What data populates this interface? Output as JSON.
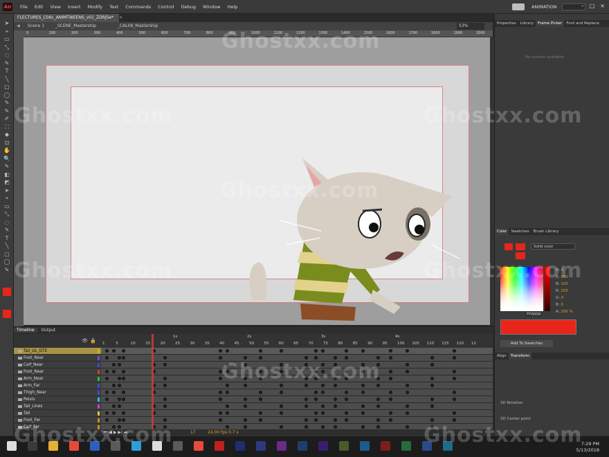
{
  "app": {
    "logo": "An",
    "menus": [
      "File",
      "Edit",
      "View",
      "Insert",
      "Modify",
      "Text",
      "Commands",
      "Control",
      "Debug",
      "Window",
      "Help"
    ],
    "workspace": "ANIMATION",
    "document_tab": "FLECTURES_C06c_ANIMTWEENS_v01_ZDRJ5e*",
    "accent": "#e8251b"
  },
  "scene": {
    "scene": "Scene 1",
    "symbol1": "_SCENE_Mastership",
    "symbol2": "_CAL08_Mastership",
    "zoom": "53%"
  },
  "ruler_ticks": [
    "0",
    "100",
    "200",
    "300",
    "400",
    "500",
    "600",
    "700",
    "800",
    "900",
    "1000",
    "1100",
    "1200",
    "1300",
    "1400",
    "1500",
    "1600",
    "1700",
    "1800",
    "1900",
    "2000"
  ],
  "timeline": {
    "tabs": [
      "Timeline",
      "Output"
    ],
    "seconds": [
      "1s",
      "2s",
      "3s",
      "4s"
    ],
    "frames": [
      "1",
      "5",
      "10",
      "15",
      "20",
      "25",
      "30",
      "35",
      "40",
      "45",
      "50",
      "55",
      "60",
      "65",
      "70",
      "75",
      "80",
      "85",
      "90",
      "95",
      "100",
      "105",
      "110",
      "115",
      "120",
      "12"
    ],
    "layers": [
      {
        "name": "Tail_UL_DTE",
        "color": "#d4b500",
        "selected": true
      },
      {
        "name": "Foot_Near",
        "color": "#7a4dd8"
      },
      {
        "name": "Calf_Near",
        "color": "#3a4bd8"
      },
      {
        "name": "Foot_Near",
        "color": "#d83a3a"
      },
      {
        "name": "Arm_Near",
        "color": "#32c032"
      },
      {
        "name": "Arm_Far",
        "color": "#3a4bd8"
      },
      {
        "name": "Thigh_Near",
        "color": "#3a4bd8"
      },
      {
        "name": "Pelvis",
        "color": "#32c0c0"
      },
      {
        "name": "Tail_Lines",
        "color": "#d83ad8"
      },
      {
        "name": "Tail",
        "color": "#d8c83a"
      },
      {
        "name": "Foot_Far",
        "color": "#d88a1a"
      },
      {
        "name": "Calf_Far",
        "color": "#d88a1a"
      }
    ],
    "footer_fps": "24.00 fps",
    "footer_frame": "17",
    "footer_time": "0.7 s"
  },
  "right_panel": {
    "tabs_top": [
      "Properties",
      "Library",
      "Frame Picker",
      "Font and Replace"
    ],
    "frame_picker_note": "No symbol available",
    "tabs_color": [
      "Color",
      "Swatches",
      "Brush Library"
    ],
    "fill_type": "Solid color",
    "hex": "FF0000",
    "h": "0",
    "s": "100",
    "b": "100",
    "r": "255",
    "g": "0",
    "bl": "0",
    "alpha": "100 %",
    "add_swatch": "Add To Swatches",
    "tabs_bottom": [
      "Align",
      "Transform"
    ],
    "rotation_label": "3D Rotation",
    "center_label": "3D Center point"
  },
  "taskbar": {
    "time": "7:29 PM",
    "date": "5/13/2018"
  },
  "watermark": "Ghostxx.com"
}
